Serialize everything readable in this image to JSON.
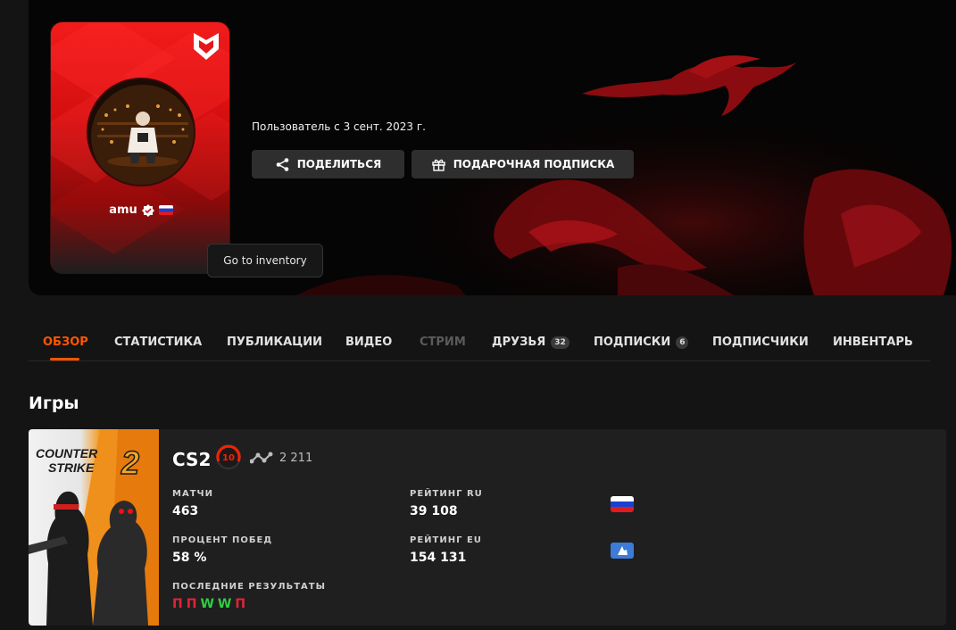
{
  "profile": {
    "username": "amu",
    "member_since": "Пользователь с 3 сент. 2023 г.",
    "share_label": "ПОДЕЛИТЬСЯ",
    "gift_label": "ПОДАРОЧНАЯ ПОДПИСКА",
    "tooltip": "Go to inventory",
    "icons": [
      "team-logo-icon",
      "verified-icon",
      "flag-ru-icon",
      "share-icon",
      "gift-icon"
    ]
  },
  "tabs": [
    {
      "label": "ОБЗОР",
      "state": "active"
    },
    {
      "label": "СТАТИСТИКА",
      "state": "normal"
    },
    {
      "label": "ПУБЛИКАЦИИ",
      "state": "normal"
    },
    {
      "label": "ВИДЕО",
      "state": "normal"
    },
    {
      "label": "СТРИМ",
      "state": "disabled"
    },
    {
      "label": "ДРУЗЬЯ",
      "badge": "32",
      "state": "normal"
    },
    {
      "label": "ПОДПИСКИ",
      "badge": "6",
      "state": "normal"
    },
    {
      "label": "ПОДПИСЧИКИ",
      "state": "normal"
    },
    {
      "label": "ИНВЕНТАРЬ",
      "state": "normal"
    }
  ],
  "games_section": {
    "title": "Игры",
    "game": {
      "cover_text_line1": "COUNTER",
      "cover_text_line2": "STRIKE",
      "cover_number": "2",
      "name": "CS2",
      "level": "10",
      "elo": "2 211",
      "stats": {
        "matches_label": "МАТЧИ",
        "matches_value": "463",
        "winrate_label": "ПРОЦЕНТ ПОБЕД",
        "winrate_value": "58 %",
        "rating_ru_label": "РЕЙТИНГ RU",
        "rating_ru_value": "39 108",
        "rating_eu_label": "РЕЙТИНГ EU",
        "rating_eu_value": "154 131",
        "recent_label": "ПОСЛЕДНИЕ РЕЗУЛЬТАТЫ",
        "recent_results": [
          "П",
          "П",
          "W",
          "W",
          "П"
        ]
      }
    }
  },
  "colors": {
    "accent": "#ff5500",
    "loss": "#e0243a",
    "win": "#2fce45",
    "card_red": "#e5161b",
    "background": "#141414"
  }
}
